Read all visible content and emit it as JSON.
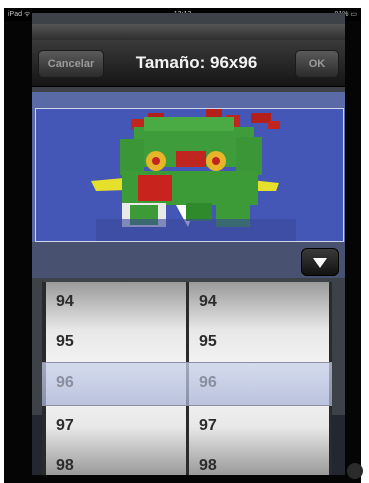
{
  "status_bar": {
    "carrier": "iPad ᯤ",
    "time": "13:13",
    "battery": "81% ▭"
  },
  "toolbar": {
    "cancel_label": "Cancelar",
    "title": "Tamaño: 96x96",
    "ok_label": "OK"
  },
  "picker": {
    "left_column": [
      "94",
      "95",
      "96",
      "97",
      "98"
    ],
    "right_column": [
      "94",
      "95",
      "96",
      "97",
      "98"
    ],
    "selected_value": "96"
  },
  "icons": {
    "dropdown": "triangle-down-icon"
  },
  "colors": {
    "toolbar": "#1f1f1f",
    "image_background": "#4558b8",
    "selection_band": "#c8d0eb"
  }
}
